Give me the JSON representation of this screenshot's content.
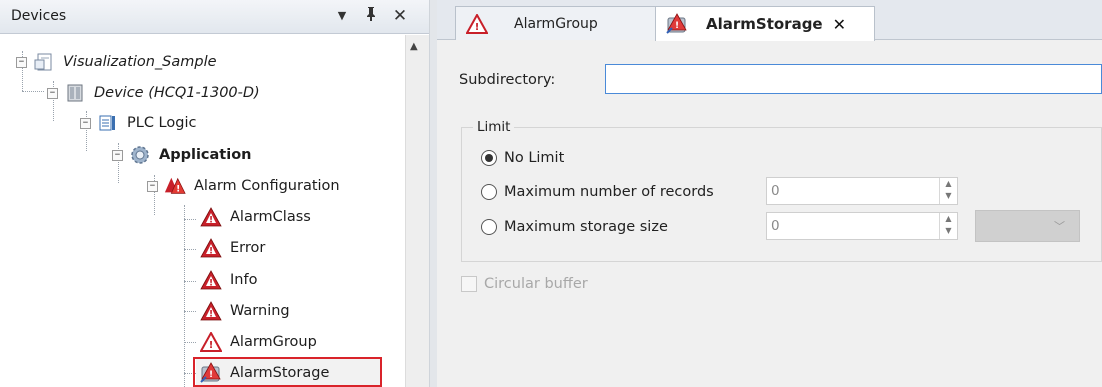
{
  "devices_panel": {
    "title": "Devices",
    "menu_glyph": "▼",
    "pin_glyph": "ᵽ",
    "close_glyph": "✕"
  },
  "tree": [
    {
      "label": "Visualization_Sample",
      "expander": "−",
      "icon": "project-icon",
      "style": "italic"
    },
    {
      "label": "Device (HCQ1-1300-D)",
      "expander": "−",
      "icon": "device-icon",
      "style": "italic"
    },
    {
      "label": "PLC Logic",
      "expander": "−",
      "icon": "plc-logic-icon",
      "style": "normal"
    },
    {
      "label": "Application",
      "expander": "−",
      "icon": "application-gear-icon",
      "style": "bold"
    },
    {
      "label": "Alarm Configuration",
      "expander": "−",
      "icon": "alarm-configuration-icon",
      "style": "normal"
    },
    {
      "label": "AlarmClass",
      "icon": "alarm-icon",
      "style": "normal"
    },
    {
      "label": "Error",
      "icon": "alarm-icon",
      "style": "normal"
    },
    {
      "label": "Info",
      "icon": "alarm-icon",
      "style": "normal"
    },
    {
      "label": "Warning",
      "icon": "alarm-icon",
      "style": "normal"
    },
    {
      "label": "AlarmGroup",
      "icon": "alarm-group-icon",
      "style": "normal"
    },
    {
      "label": "AlarmStorage",
      "icon": "alarm-storage-icon",
      "style": "normal",
      "selected": true
    }
  ],
  "tree_scroll": {
    "up_glyph": "▲",
    "down_glyph": "▼"
  },
  "tabs": [
    {
      "label": "AlarmGroup",
      "icon": "alarm-group-icon",
      "active": false
    },
    {
      "label": "AlarmStorage",
      "icon": "alarm-storage-icon",
      "active": true,
      "close_glyph": "✕"
    }
  ],
  "form": {
    "subdirectory_label": "Subdirectory:",
    "subdirectory_value": "",
    "limit_group_label": "Limit",
    "options": [
      {
        "label": "No Limit",
        "checked": true
      },
      {
        "label": "Maximum number of records",
        "checked": false,
        "value": "0"
      },
      {
        "label": "Maximum storage size",
        "checked": false,
        "value": "0",
        "unit": ""
      }
    ],
    "circular_buffer_label": "Circular buffer",
    "circular_buffer_checked": false
  },
  "colors": {
    "highlight": "#d9232a",
    "alarm_red": "#c8202a",
    "input_focus": "#4a8ad8"
  }
}
